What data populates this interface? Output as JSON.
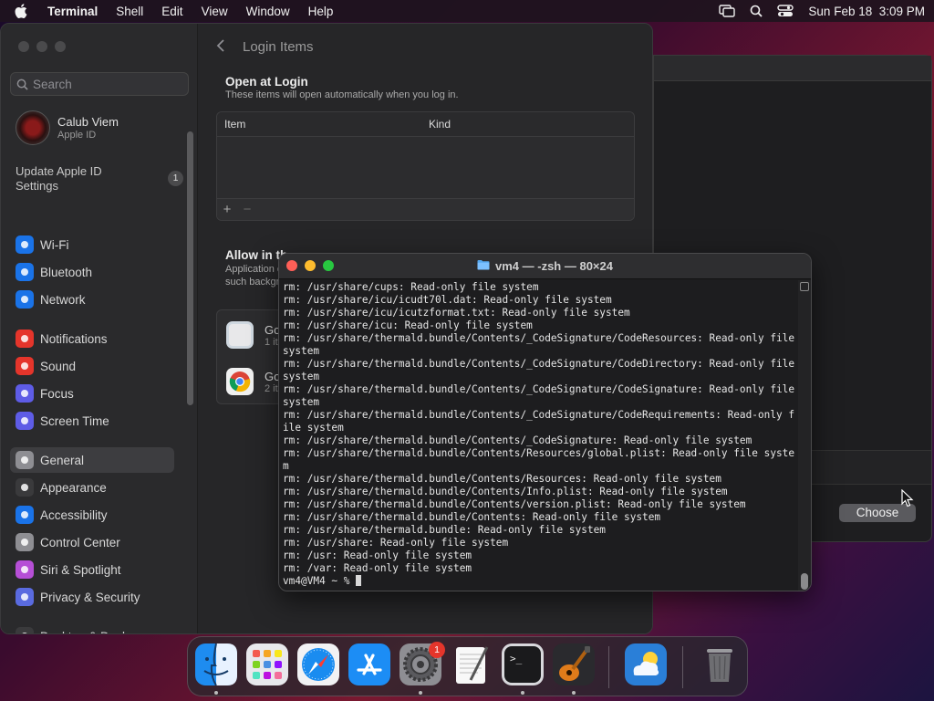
{
  "menubar": {
    "app_name": "Terminal",
    "items": [
      "Shell",
      "Edit",
      "View",
      "Window",
      "Help"
    ],
    "datetime": "Sun Feb 18  3:09 PM"
  },
  "settings": {
    "search_placeholder": "Search",
    "account": {
      "name": "Calub Viem",
      "subtitle": "Apple ID"
    },
    "update": {
      "label": "Update Apple ID Settings",
      "badge": "1"
    },
    "sidebar_items": [
      {
        "label": "Wi-Fi",
        "icon": "wifi-icon",
        "color": "#1a73e8"
      },
      {
        "label": "Bluetooth",
        "icon": "bluetooth-icon",
        "color": "#1a73e8"
      },
      {
        "label": "Network",
        "icon": "globe-icon",
        "color": "#1a73e8"
      },
      {
        "label": "Notifications",
        "icon": "bell-icon",
        "color": "#e5352b"
      },
      {
        "label": "Sound",
        "icon": "speaker-icon",
        "color": "#e5352b"
      },
      {
        "label": "Focus",
        "icon": "moon-icon",
        "color": "#5e5ce6"
      },
      {
        "label": "Screen Time",
        "icon": "hourglass-icon",
        "color": "#5e5ce6"
      },
      {
        "label": "General",
        "icon": "gear-icon",
        "color": "#8e8e93"
      },
      {
        "label": "Appearance",
        "icon": "appearance-icon",
        "color": "#3a3a3c"
      },
      {
        "label": "Accessibility",
        "icon": "accessibility-icon",
        "color": "#1a73e8"
      },
      {
        "label": "Control Center",
        "icon": "control-center-icon",
        "color": "#8e8e93"
      },
      {
        "label": "Siri & Spotlight",
        "icon": "siri-icon",
        "color": "#b64fd6"
      },
      {
        "label": "Privacy & Security",
        "icon": "hand-icon",
        "color": "#5a6be0"
      },
      {
        "label": "Desktop & Dock",
        "icon": "dock-icon",
        "color": "#3a3a3c"
      }
    ],
    "selected_item": "General",
    "main": {
      "title": "Login Items",
      "open_at_login": {
        "title": "Open at Login",
        "subtitle": "These items will open automatically when you log in.",
        "columns": [
          "Item",
          "Kind"
        ],
        "add": "+",
        "remove": "−"
      },
      "allow": {
        "title": "Allow in th",
        "subtitle": "Application open, such backgroun",
        "rows": [
          {
            "name": "Go",
            "detail": "1 it"
          },
          {
            "name": "Go",
            "detail": "2 it"
          }
        ]
      }
    }
  },
  "background_window": {
    "button_label": "Choose"
  },
  "terminal": {
    "title": "vm4 — -zsh — 80×24",
    "lines": [
      "rm: /usr/share/cups: Read-only file system",
      "rm: /usr/share/icu/icudt70l.dat: Read-only file system",
      "rm: /usr/share/icu/icutzformat.txt: Read-only file system",
      "rm: /usr/share/icu: Read-only file system",
      "rm: /usr/share/thermald.bundle/Contents/_CodeSignature/CodeResources: Read-only file system",
      "rm: /usr/share/thermald.bundle/Contents/_CodeSignature/CodeDirectory: Read-only file system",
      "rm: /usr/share/thermald.bundle/Contents/_CodeSignature/CodeSignature: Read-only file system",
      "rm: /usr/share/thermald.bundle/Contents/_CodeSignature/CodeRequirements: Read-only file system",
      "rm: /usr/share/thermald.bundle/Contents/_CodeSignature: Read-only file system",
      "rm: /usr/share/thermald.bundle/Contents/Resources/global.plist: Read-only file system",
      "rm: /usr/share/thermald.bundle/Contents/Resources: Read-only file system",
      "rm: /usr/share/thermald.bundle/Contents/Info.plist: Read-only file system",
      "rm: /usr/share/thermald.bundle/Contents/version.plist: Read-only file system",
      "rm: /usr/share/thermald.bundle/Contents: Read-only file system",
      "rm: /usr/share/thermald.bundle: Read-only file system",
      "rm: /usr/share: Read-only file system",
      "rm: /usr: Read-only file system",
      "rm: /var: Read-only file system"
    ],
    "prompt": "vm4@VM4 ~ % "
  },
  "dock": {
    "items": [
      {
        "name": "finder",
        "running": true
      },
      {
        "name": "launchpad",
        "running": false
      },
      {
        "name": "safari",
        "running": false
      },
      {
        "name": "app-store",
        "running": false
      },
      {
        "name": "system-settings",
        "running": true,
        "badge": "1"
      },
      {
        "name": "textedit",
        "running": false
      },
      {
        "name": "terminal",
        "running": true
      },
      {
        "name": "garageband",
        "running": true
      },
      {
        "name": "weather",
        "running": false
      },
      {
        "name": "trash",
        "running": false
      }
    ]
  }
}
